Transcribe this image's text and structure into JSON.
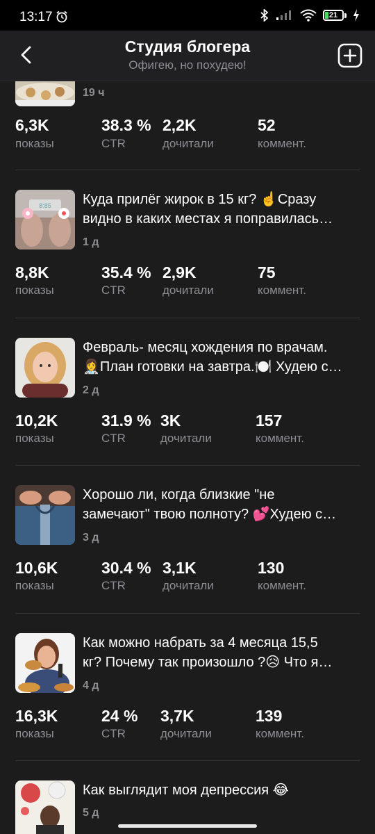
{
  "status": {
    "time": "13:17",
    "battery": "21",
    "battery_level": 0.21
  },
  "header": {
    "title": "Студия блогера",
    "subtitle": "Офигею, но похудею!"
  },
  "stat_labels": {
    "views": "показы",
    "ctr": "CTR",
    "reads": "дочитали",
    "comments": "коммент."
  },
  "posts": [
    {
      "title": "",
      "time": "19 ч",
      "views": "6,3K",
      "ctr": "38.3 %",
      "reads": "2,2K",
      "comments": "52"
    },
    {
      "title": "Куда прилёг жирок в 15 кг? ☝️Сразу",
      "title2": "видно в каких местах я поправилась…",
      "time": "1 д",
      "views": "8,8K",
      "ctr": "35.4 %",
      "reads": "2,9K",
      "comments": "75"
    },
    {
      "title": "Февраль- месяц хождения по врачам.",
      "title2": "👩‍⚕️План готовки на завтра.🍽️ Худею с…",
      "time": "2 д",
      "views": "10,2K",
      "ctr": "31.9 %",
      "reads": "3K",
      "comments": "157"
    },
    {
      "title": "Хорошо ли, когда близкие \"не",
      "title2": "замечают\" твою полноту? 💕Худею с…",
      "time": "3 д",
      "views": "10,6K",
      "ctr": "30.4 %",
      "reads": "3,1K",
      "comments": "130"
    },
    {
      "title": "Как можно набрать за 4 месяца 15,5",
      "title2": "кг? Почему так произошло ?😥 Что я…",
      "time": "4 д",
      "views": "16,3K",
      "ctr": "24 %",
      "reads": "3,7K",
      "comments": "139"
    },
    {
      "title": "Как выглядит моя депрессия 😂",
      "time": "5 д"
    }
  ],
  "icons": {
    "back": "back-arrow-icon",
    "add": "add-square-icon",
    "alarm": "alarm-icon",
    "bluetooth": "bluetooth-icon",
    "signal": "signal-icon",
    "wifi": "wifi-icon",
    "charging": "charging-icon"
  }
}
